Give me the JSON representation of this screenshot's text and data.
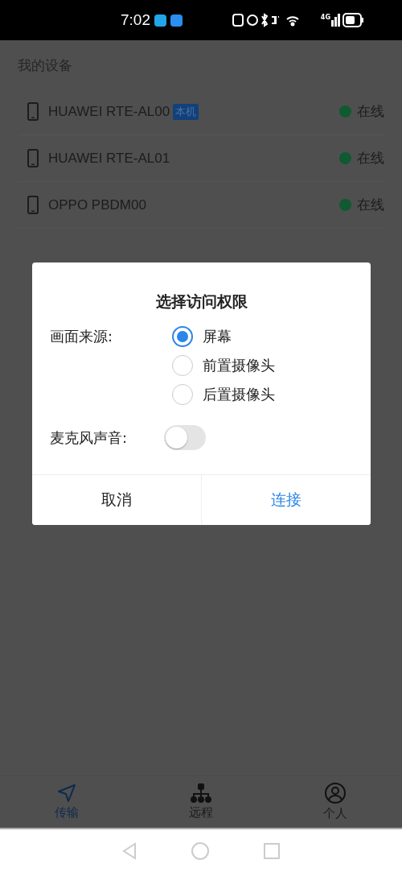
{
  "status_bar": {
    "time": "7:02",
    "network": "4G"
  },
  "section_title": "我的设备",
  "devices": [
    {
      "name": "HUAWEI RTE-AL00",
      "tag": "本机",
      "status": "在线",
      "color": "#0f5a30"
    },
    {
      "name": "HUAWEI RTE-AL01",
      "status": "在线",
      "color": "#0f5a30"
    },
    {
      "name": "OPPO PBDM00",
      "status": "在线",
      "color": "#0f5a30"
    }
  ],
  "dialog": {
    "title": "选择访问权限",
    "source_label": "画面来源:",
    "options": [
      {
        "label": "屏幕",
        "selected": true
      },
      {
        "label": "前置摄像头",
        "selected": false
      },
      {
        "label": "后置摄像头",
        "selected": false
      }
    ],
    "mic_label": "麦克风声音:",
    "mic_on": false,
    "buttons": [
      {
        "label": "取消",
        "kind": "cancel"
      },
      {
        "label": "连接",
        "kind": "confirm"
      }
    ]
  },
  "tabs": [
    {
      "label": "传输",
      "kind": "send",
      "selected": true
    },
    {
      "label": "远程",
      "kind": "network",
      "selected": false
    },
    {
      "label": "个人",
      "kind": "user",
      "selected": false
    }
  ]
}
